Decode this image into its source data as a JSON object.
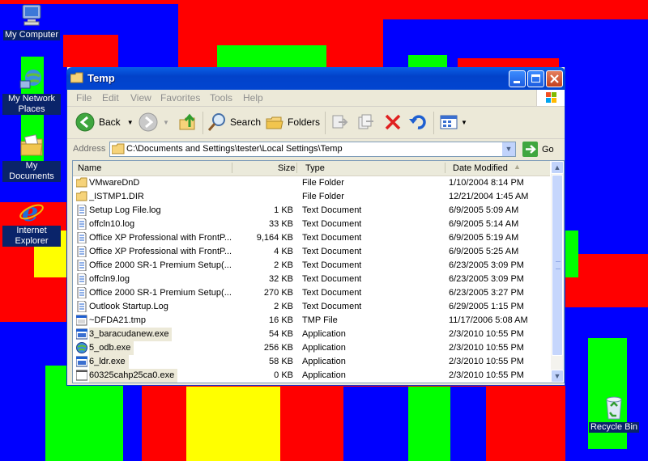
{
  "desktop": {
    "icons": [
      {
        "label": "My Computer"
      },
      {
        "label": "My Network Places"
      },
      {
        "label": "My Documents"
      },
      {
        "label": "Internet Explorer"
      },
      {
        "label": "Recycle Bin"
      }
    ]
  },
  "window": {
    "title": "Temp",
    "menu": [
      "File",
      "Edit",
      "View",
      "Favorites",
      "Tools",
      "Help"
    ],
    "toolbar": {
      "back": "Back",
      "search": "Search",
      "folders": "Folders",
      "go": "Go"
    },
    "address_label": "Address",
    "address_value": "C:\\Documents and Settings\\tester\\Local Settings\\Temp",
    "columns": [
      "Name",
      "Size",
      "Type",
      "Date Modified"
    ],
    "files": [
      {
        "name": "VMwareDnD",
        "size": "",
        "type": "File Folder",
        "date": "1/10/2004 8:14 PM",
        "icon": "folder-icon"
      },
      {
        "name": "_ISTMP1.DIR",
        "size": "",
        "type": "File Folder",
        "date": "12/21/2004 1:45 AM",
        "icon": "folder-icon"
      },
      {
        "name": "Setup Log File.log",
        "size": "1 KB",
        "type": "Text Document",
        "date": "6/9/2005 5:09 AM",
        "icon": "text-file-icon"
      },
      {
        "name": "offcln10.log",
        "size": "33 KB",
        "type": "Text Document",
        "date": "6/9/2005 5:14 AM",
        "icon": "text-file-icon"
      },
      {
        "name": "Office XP Professional with FrontP...",
        "size": "9,164 KB",
        "type": "Text Document",
        "date": "6/9/2005 5:19 AM",
        "icon": "text-file-icon"
      },
      {
        "name": "Office XP Professional with FrontP...",
        "size": "4 KB",
        "type": "Text Document",
        "date": "6/9/2005 5:25 AM",
        "icon": "text-file-icon"
      },
      {
        "name": "Office 2000 SR-1 Premium Setup(...",
        "size": "2 KB",
        "type": "Text Document",
        "date": "6/23/2005 3:09 PM",
        "icon": "text-file-icon"
      },
      {
        "name": "offcln9.log",
        "size": "32 KB",
        "type": "Text Document",
        "date": "6/23/2005 3:09 PM",
        "icon": "text-file-icon"
      },
      {
        "name": "Office 2000 SR-1 Premium Setup(...",
        "size": "270 KB",
        "type": "Text Document",
        "date": "6/23/2005 3:27 PM",
        "icon": "text-file-icon"
      },
      {
        "name": "Outlook Startup.Log",
        "size": "2 KB",
        "type": "Text Document",
        "date": "6/29/2005 1:15 PM",
        "icon": "text-file-icon"
      },
      {
        "name": "~DFDA21.tmp",
        "size": "16 KB",
        "type": "TMP File",
        "date": "11/17/2006 5:08 AM",
        "icon": "tmp-file-icon"
      },
      {
        "name": "3_baracudanew.exe",
        "size": "54 KB",
        "type": "Application",
        "date": "2/3/2010 10:55 PM",
        "icon": "application-icon"
      },
      {
        "name": "5_odb.exe",
        "size": "256 KB",
        "type": "Application",
        "date": "2/3/2010 10:55 PM",
        "icon": "globe-application-icon"
      },
      {
        "name": "6_ldr.exe",
        "size": "58 KB",
        "type": "Application",
        "date": "2/3/2010 10:55 PM",
        "icon": "application-icon"
      },
      {
        "name": "60325cahp25ca0.exe",
        "size": "0 KB",
        "type": "Application",
        "date": "2/3/2010 10:55 PM",
        "icon": "blank-application-icon"
      }
    ]
  },
  "colors": {
    "desktop_red": "#ff0000",
    "desktop_blue": "#0000ff",
    "desktop_green": "#00ff00",
    "desktop_yellow": "#ffff00",
    "titlebar_blue": "#0542d0"
  }
}
